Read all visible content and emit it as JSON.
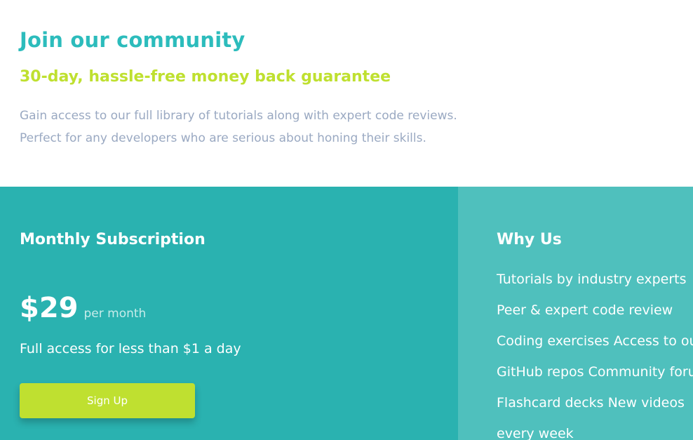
{
  "hero": {
    "title": "Join our community",
    "subtitle": "30-day, hassle-free money back guarantee",
    "description": "Gain access to our full library of tutorials along with expert code reviews. Perfect for any developers who are serious about honing their skills."
  },
  "subscription": {
    "heading": "Monthly Subscription",
    "price": "$29",
    "period": "per month",
    "tagline": "Full access for less than $1 a day",
    "signup_label": "Sign Up"
  },
  "why_us": {
    "heading": "Why Us",
    "text": "Tutorials by industry experts Peer & expert code review Coding exercises Access to our GitHub repos Community forum Flashcard decks New videos every week"
  },
  "colors": {
    "title": "#2cbcbc",
    "subtitle": "#bfe030",
    "description": "#9aa9c2",
    "left_panel": "#2ab2b0",
    "right_panel": "#4fc0bd",
    "button": "#bfe030"
  }
}
